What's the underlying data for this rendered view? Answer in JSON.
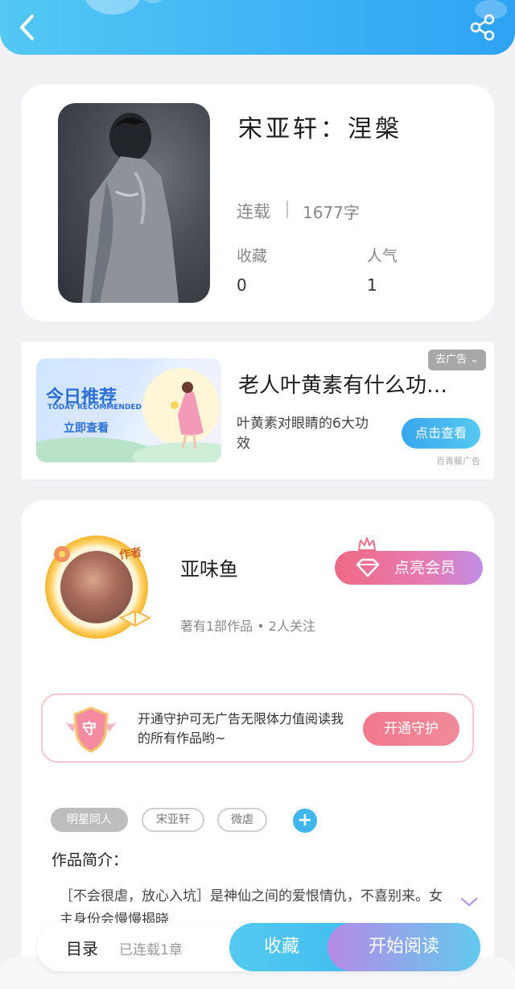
{
  "header": {
    "back_icon": "chevron-left-icon",
    "share_icon": "share-icon",
    "color": "#3fb3f5"
  },
  "book": {
    "title": "宋亚轩：涅槃",
    "status": "连载",
    "word_count": "1677字",
    "favorites_label": "收藏",
    "favorites_value": "0",
    "popularity_label": "人气",
    "popularity_value": "1"
  },
  "ad": {
    "banner_title": "今日推荐",
    "banner_subtitle": "TODAY RECOMMENDED",
    "banner_cta": "立即查看",
    "title": "老人叶黄素有什么功…",
    "description": "叶黄素对眼睛的6大功效",
    "close_label": "去广告",
    "button_label": "点击查看",
    "source": "百青藤广告"
  },
  "author": {
    "badge": "作者",
    "name": "亚味鱼",
    "meta": "著有1部作品 • 2人关注",
    "vip_button": "点亮会员",
    "guard_icon_text": "守",
    "guard_text": "开通守护可无广告无限体力值阅读我的所有作品哟~",
    "guard_button": "开通守护"
  },
  "tags": [
    "明星同人",
    "宋亚轩",
    "微虐"
  ],
  "intro": {
    "heading": "作品简介：",
    "text": "［不会很虐，放心入坑］是神仙之间的爱恨情仇，不喜别来。女主身份会慢慢揭晓"
  },
  "bottom": {
    "toc_label": "目录",
    "toc_status": "已连载1章",
    "favorite_button": "收藏",
    "read_button": "开始阅读"
  }
}
